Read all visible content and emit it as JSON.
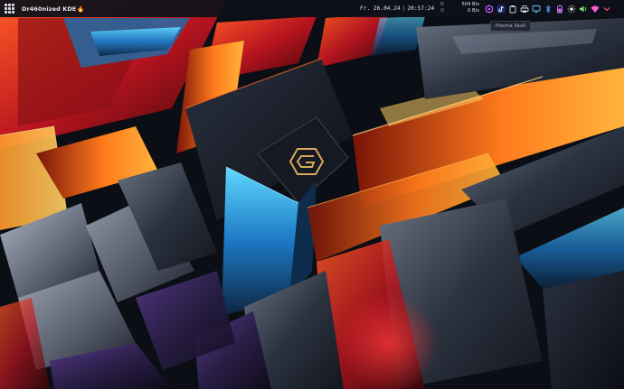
{
  "panel": {
    "launcher_icon": "app-grid-icon",
    "hostname": "Dr460nized KDE",
    "hostname_emoji": "🔥",
    "clock": {
      "date": "Fr. 26.04.24",
      "separator": "|",
      "time": "20:57:24"
    },
    "network": {
      "download_label": "D",
      "upload_label": "U",
      "download_rate": "504 B/s",
      "upload_rate": "0 B/s"
    },
    "tray_icons": [
      {
        "name": "updates-icon",
        "color": "#c65bff"
      },
      {
        "name": "tiktok-icon",
        "color": "#ffffff"
      },
      {
        "name": "clipboard-icon",
        "color": "#d5dae3"
      },
      {
        "name": "printer-icon",
        "color": "#d5dae3"
      },
      {
        "name": "display-icon",
        "color": "#6cc3ff"
      },
      {
        "name": "bluetooth-icon",
        "color": "#4d9bff"
      },
      {
        "name": "battery-icon",
        "color": "#d478ff"
      },
      {
        "name": "brightness-icon",
        "color": "#e6e8ee"
      },
      {
        "name": "volume-icon",
        "color": "#7ce86e"
      },
      {
        "name": "wifi-icon",
        "color": "#ff5fc8"
      },
      {
        "name": "chevron-down-icon",
        "color": "#ff5a6b"
      }
    ]
  },
  "tooltip": {
    "text": "Plasma Vault"
  },
  "wallpaper": {
    "logo_icon": "garuda-logo-icon",
    "accent_colors": [
      "#ff6a1a",
      "#d01f2c",
      "#2ab8f0",
      "#d9a85a"
    ]
  }
}
